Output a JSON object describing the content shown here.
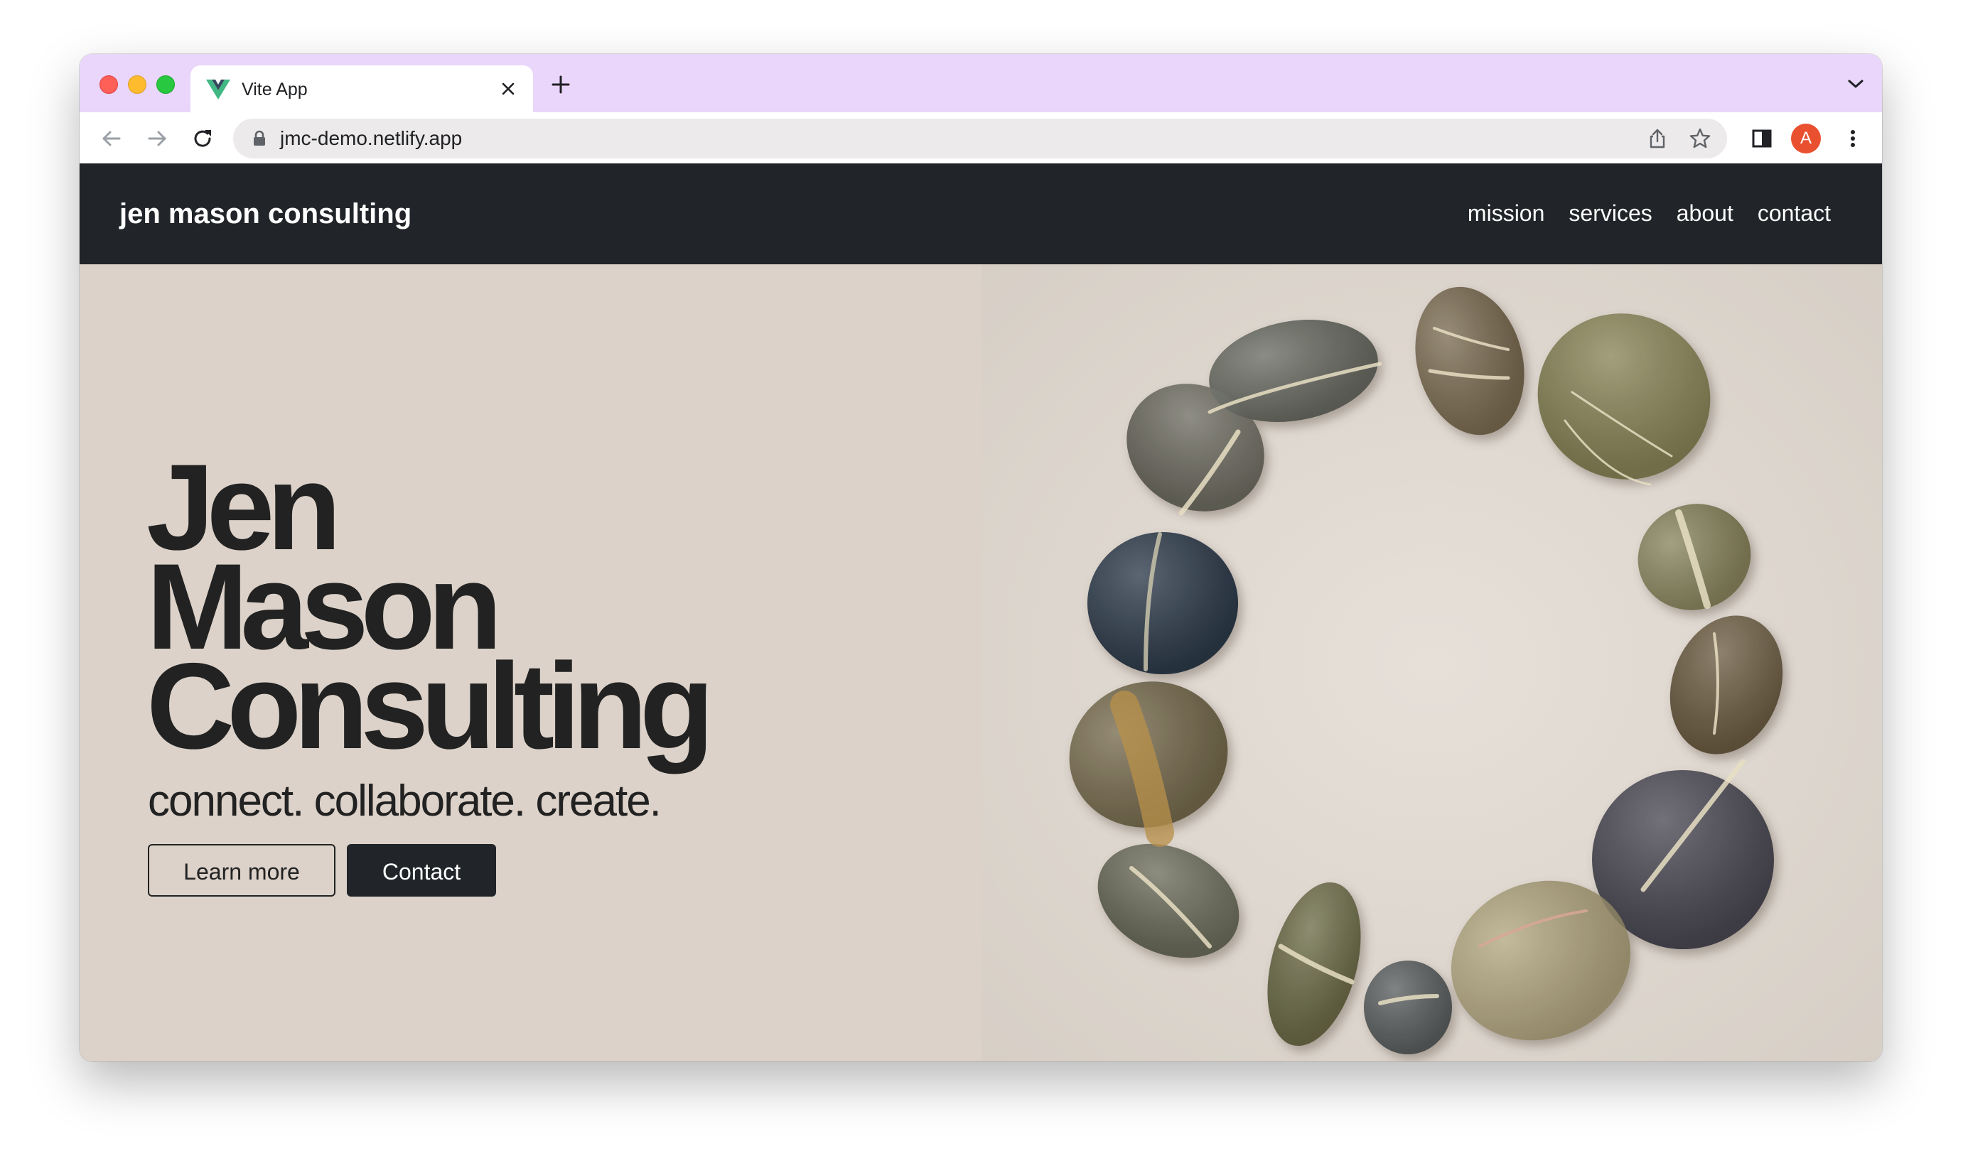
{
  "browser": {
    "tab_title": "Vite App",
    "url": "jmc-demo.netlify.app",
    "profile_initial": "A",
    "accent_color": "#ead5fb",
    "icons": [
      "vue-logo-icon",
      "close-icon",
      "plus-icon",
      "chevron-down-icon",
      "back-arrow-icon",
      "forward-arrow-icon",
      "reload-icon",
      "lock-icon",
      "share-icon",
      "star-icon",
      "side-panel-icon",
      "kebab-menu-icon"
    ]
  },
  "site": {
    "brand": "jen mason consulting",
    "nav": [
      {
        "label": "mission"
      },
      {
        "label": "services"
      },
      {
        "label": "about"
      },
      {
        "label": "contact"
      }
    ],
    "hero": {
      "title_lines": [
        "Jen",
        "Mason",
        "Consulting"
      ],
      "subtitle": "connect. collaborate. create.",
      "learn_more": "Learn more",
      "contact": "Contact",
      "image": "stones-circle-on-sand"
    },
    "colors": {
      "nav_bg": "#212529",
      "hero_bg": "#dcd2c9",
      "text_dark": "#222222"
    }
  }
}
